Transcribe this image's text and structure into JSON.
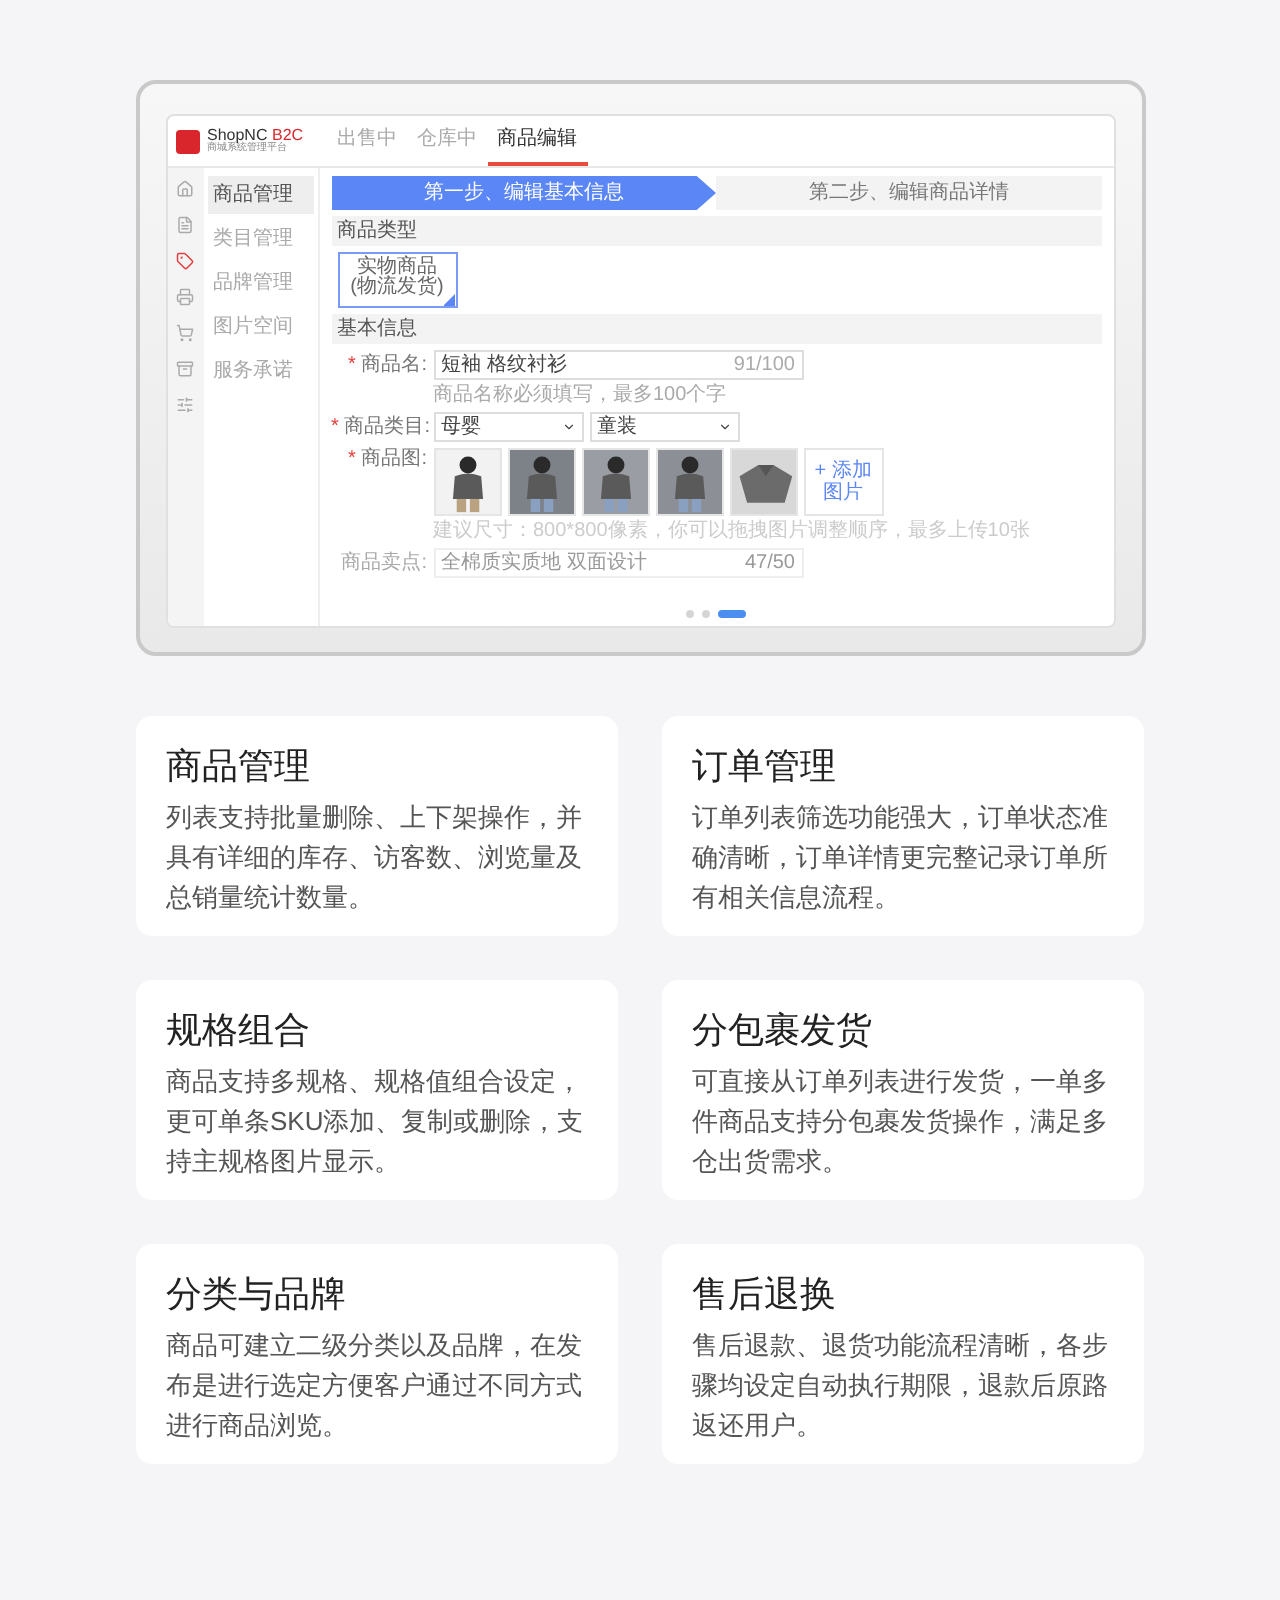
{
  "preview": {
    "logo": {
      "brand": "ShopNC",
      "edition": "B2C",
      "subtitle": "商城系统管理平台"
    },
    "tabs": [
      {
        "label": "出售中",
        "selected": false
      },
      {
        "label": "仓库中",
        "selected": false
      },
      {
        "label": "商品编辑",
        "selected": true
      }
    ],
    "rail_icons": [
      {
        "kind": "home",
        "selected": false
      },
      {
        "kind": "file",
        "selected": false
      },
      {
        "kind": "tag",
        "selected": true
      },
      {
        "kind": "printer",
        "selected": false
      },
      {
        "kind": "cart",
        "selected": false
      },
      {
        "kind": "box",
        "selected": false
      },
      {
        "kind": "sliders",
        "selected": false
      }
    ],
    "menu": [
      {
        "label": "商品管理",
        "selected": true
      },
      {
        "label": "类目管理",
        "selected": false
      },
      {
        "label": "品牌管理",
        "selected": false
      },
      {
        "label": "图片空间",
        "selected": false
      },
      {
        "label": "服务承诺",
        "selected": false
      }
    ],
    "steps": [
      {
        "label": "第一步、编辑基本信息",
        "selected": true
      },
      {
        "label": "第二步、编辑商品详情",
        "selected": false
      }
    ],
    "type_section": "商品类型",
    "type_option": {
      "title": "实物商品",
      "note": "(物流发货)",
      "selected": true
    },
    "basic_section": "基本信息",
    "name_field": {
      "mark": "*",
      "label": "商品名:",
      "value": "短袖 格纹衬衫",
      "counter": "91/100",
      "hint": "商品名称必须填写，最多100个字"
    },
    "category_field": {
      "mark": "*",
      "label": "商品类目:",
      "first": "母婴",
      "second": "童装"
    },
    "images_field": {
      "mark": "*",
      "label": "商品图:",
      "add": "+ 添加图片",
      "hint": "建议尺寸：800*800像素，你可以拖拽图片调整顺序，最多上传10张"
    },
    "selling_field": {
      "label": "商品卖点:",
      "value": "全棉质实质地 双面设计",
      "counter": "47/50"
    },
    "dots": [
      {
        "selected": false
      },
      {
        "selected": false
      },
      {
        "selected": true
      }
    ]
  },
  "features": [
    {
      "title": "商品管理",
      "text": "列表支持批量删除、上下架操作，并具有详细的库存、访客数、浏览量及总销量统计数量。"
    },
    {
      "title": "订单管理",
      "text": "订单列表筛选功能强大，订单状态准确清晰，订单详情更完整记录订单所有相关信息流程。"
    },
    {
      "title": "规格组合",
      "text": "商品支持多规格、规格值组合设定，更可单条SKU添加、复制或删除，支持主规格图片显示。"
    },
    {
      "title": "分包裹发货",
      "text": "可直接从订单列表进行发货，一单多件商品支持分包裹发货操作，满足多仓出货需求。"
    },
    {
      "title": "分类与品牌",
      "text": "商品可建立二级分类以及品牌，在发布是进行选定方便客户通过不同方式进行商品浏览。"
    },
    {
      "title": "售后退换",
      "text": "售后退款、退货功能流程清晰，各步骤均设定自动执行期限，退款后原路返还用户。"
    }
  ]
}
